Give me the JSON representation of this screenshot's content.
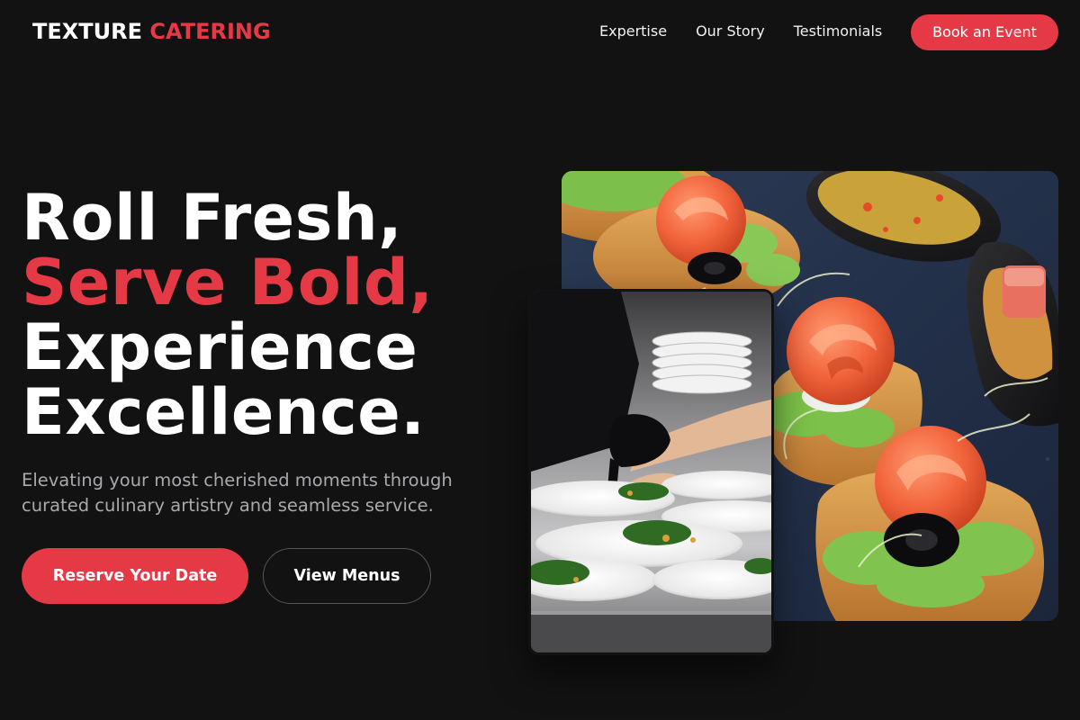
{
  "brand": {
    "name_part1": "TEXTURE",
    "name_part2": "CATERING",
    "accent_color": "#e63946"
  },
  "nav": {
    "links": [
      {
        "label": "Expertise"
      },
      {
        "label": "Our Story"
      },
      {
        "label": "Testimonials"
      }
    ],
    "cta_label": "Book an Event"
  },
  "hero": {
    "headline": {
      "line1": "Roll Fresh,",
      "line2": "Serve Bold,",
      "line3": "Experience",
      "line4": "Excellence."
    },
    "subtitle": "Elevating your most cherished moments through curated culinary artistry and seamless service.",
    "primary_button": "Reserve Your Date",
    "secondary_button": "View Menus"
  },
  "images": {
    "main_alt": "Salmon rose crostini canapés on slate with microgreens and olives",
    "secondary_alt": "Chef plating dishes on a row of white plates in a kitchen"
  },
  "colors": {
    "background": "#121213",
    "accent": "#e63946",
    "text": "#ffffff",
    "muted": "#a9a9ae"
  }
}
